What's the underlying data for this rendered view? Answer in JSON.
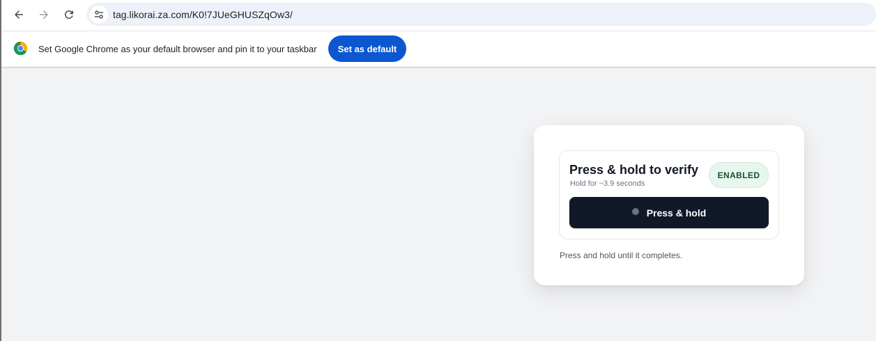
{
  "browser": {
    "url": "tag.likorai.za.com/K0!7JUeGHUSZqOw3/",
    "icons": {
      "back": "back-arrow-icon",
      "forward": "forward-arrow-icon",
      "reload": "reload-icon",
      "site_info": "tune-icon"
    }
  },
  "infobar": {
    "icon": "chrome-logo-icon",
    "message": "Set Google Chrome as your default browser and pin it to your taskbar",
    "button_label": "Set as default"
  },
  "verify_card": {
    "title": "Press & hold to verify",
    "subtitle": "Hold for ~3.9 seconds",
    "badge": "ENABLED",
    "button_label": "Press & hold",
    "footnote": "Press and hold until it completes."
  },
  "colors": {
    "page_background": "#f2f3f5",
    "accent_blue": "#0b57d0",
    "hold_button": "#111827",
    "badge_bg": "#e7f6ee",
    "badge_text": "#14532d"
  }
}
